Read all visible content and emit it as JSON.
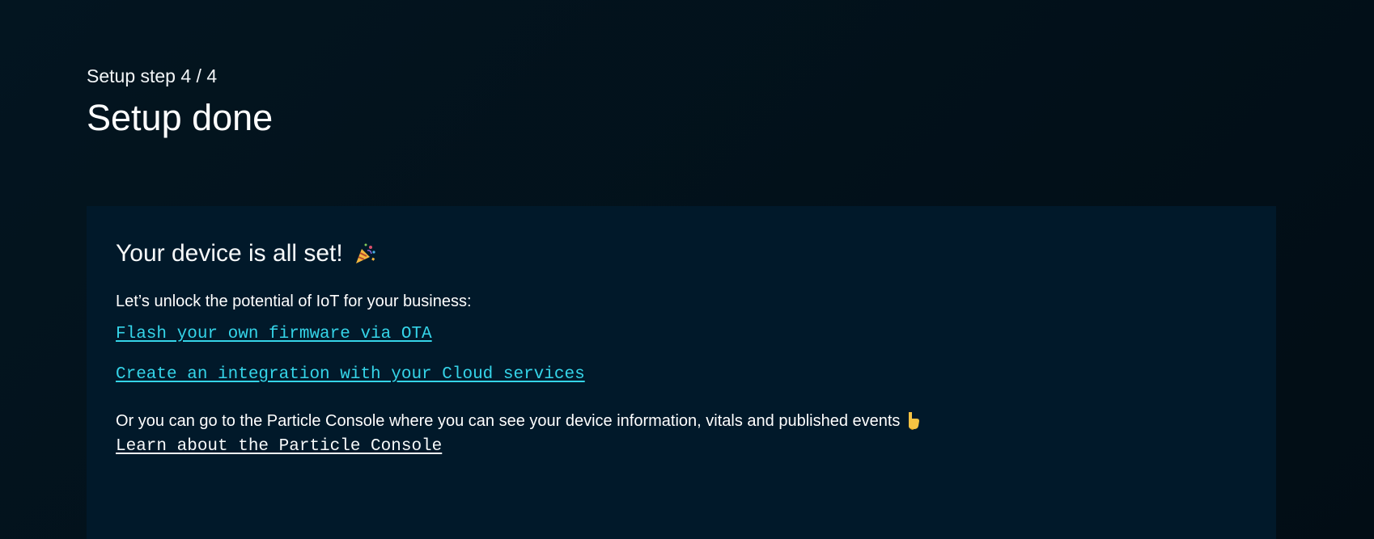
{
  "header": {
    "step_label": "Setup step 4 / 4",
    "title": "Setup done"
  },
  "card": {
    "title": "Your device is all set!",
    "title_icon": "party-popper-icon",
    "intro": "Let’s unlock the potential of IoT for your business:",
    "links": [
      "Flash your own firmware via OTA",
      "Create an integration with your Cloud services"
    ],
    "console_text": "Or you can go to the Particle Console where you can see your device information, vitals and published events",
    "console_icon": "pointing-down-icon",
    "console_link": "Learn about the Particle Console"
  },
  "colors": {
    "background": "#031520",
    "card_background": "#01192a",
    "link_accent": "#35d4e8",
    "text": "#ffffff"
  }
}
